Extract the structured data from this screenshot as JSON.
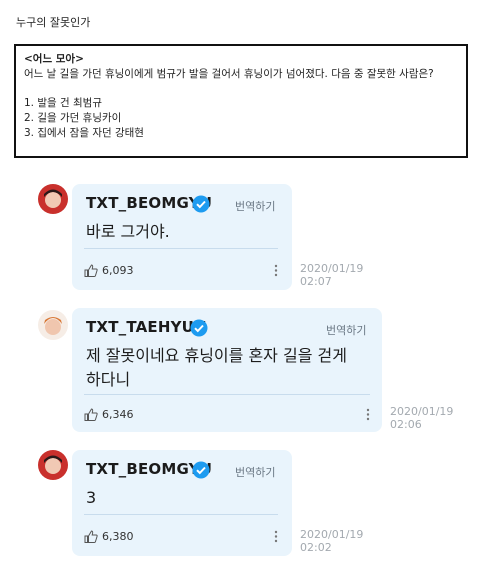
{
  "page_title": "누구의 잘못인가",
  "quiz": {
    "heading": "<어느 모아>",
    "question": "어느 날 길을 가던 휴닝이에게 범규가 발을 걸어서 휴닝이가 넘어졌다. 다음 중 잘못한 사람은?",
    "options": [
      "1. 발을 건 최범규",
      "2. 길을 가던 휴닝카이",
      "3. 집에서 잠을 자던 강태현"
    ]
  },
  "posts": [
    {
      "username": "TXT_BEOMGYU",
      "translate_label": "번역하기",
      "message": "바로 그거야.",
      "likes": "6,093",
      "date": "2020/01/19",
      "time": "02:07",
      "avatar_color": "#c9302c"
    },
    {
      "username": "TXT_TAEHYUN",
      "translate_label": "번역하기",
      "message_line1": "제 잘못이네요 휴닝이를 혼자 길을 걷게",
      "message_line2": "하다니",
      "likes": "6,346",
      "date": "2020/01/19",
      "time": "02:06",
      "avatar_color": "#f2d4c2"
    },
    {
      "username": "TXT_BEOMGYU",
      "translate_label": "번역하기",
      "message": "3",
      "likes": "6,380",
      "date": "2020/01/19",
      "time": "02:02",
      "avatar_color": "#c9302c"
    }
  ],
  "colors": {
    "card_background": "#e9f4fc",
    "verified_blue": "#1d9bf0",
    "timestamp_gray": "#a3a9af"
  }
}
